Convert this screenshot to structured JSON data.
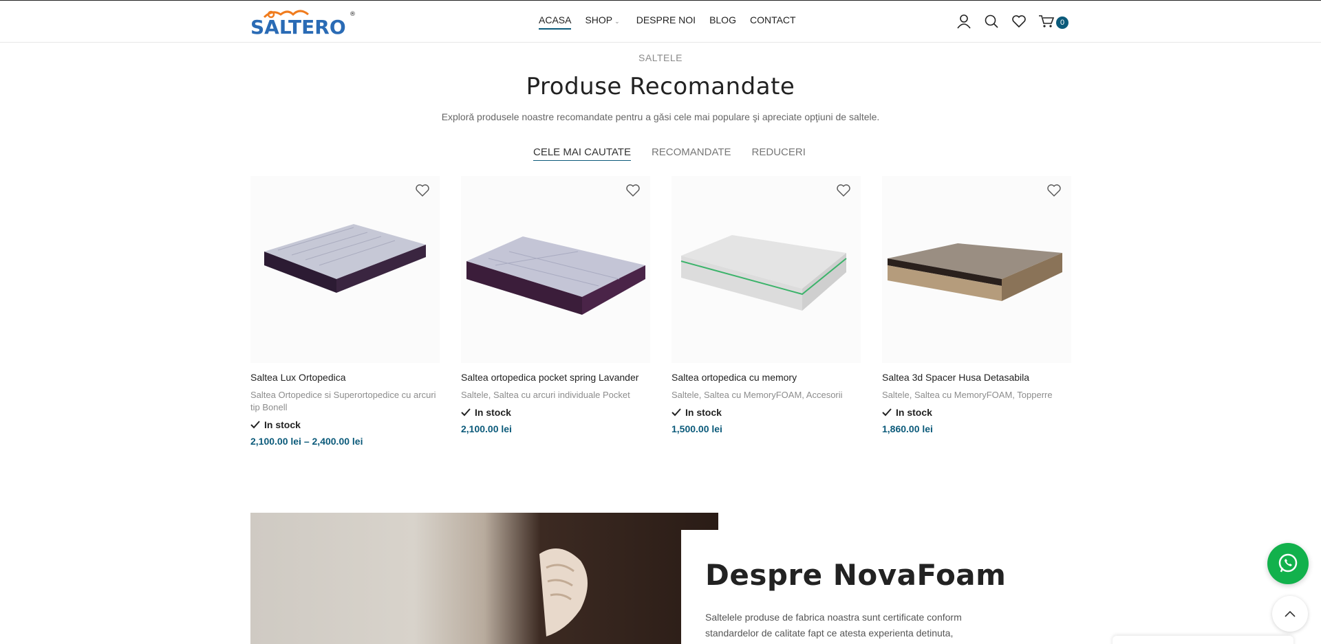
{
  "header": {
    "logo_text": "SALTERO",
    "nav": [
      {
        "label": "ACASA"
      },
      {
        "label": "SHOP"
      },
      {
        "label": "DESPRE NOI"
      },
      {
        "label": "BLOG"
      },
      {
        "label": "CONTACT"
      }
    ],
    "cart_count": "0",
    "icons": [
      "user-icon",
      "search-icon",
      "heart-icon",
      "cart-icon"
    ]
  },
  "section": {
    "eyebrow": "SALTELE",
    "title": "Produse Recomandate",
    "subtitle": "Explorǎ produsele noastre recomandate pentru a gǎsi cele mai populare şi apreciate opţiuni de saltele.",
    "tabs": [
      "CELE MAI CAUTATE",
      "RECOMANDATE",
      "REDUCERI"
    ],
    "active_tab": "CELE MAI CAUTATE"
  },
  "products": [
    {
      "name": "Saltea Lux Ortopedica",
      "categories": "Saltea Ortopedice si Superortopedice cu arcuri tip Bonell",
      "stock": "In stock",
      "price": "2,100.00 lei – 2,400.00 lei"
    },
    {
      "name": "Saltea ortopedica pocket spring Lavander",
      "categories": "Saltele, Saltea cu arcuri individuale Pocket",
      "stock": "In stock",
      "price": "2,100.00 lei"
    },
    {
      "name": "Saltea ortopedica cu memory",
      "categories": "Saltele, Saltea cu MemoryFOAM, Accesorii",
      "stock": "In stock",
      "price": "1,500.00 lei"
    },
    {
      "name": "Saltea 3d Spacer Husa Detasabila",
      "categories": "Saltele, Saltea cu MemoryFOAM, Topperre",
      "stock": "In stock",
      "price": "1,860.00 lei"
    }
  ],
  "about": {
    "title": "Despre NovaFoam",
    "text": "Saltelele produse de fabrica noastra sunt certificate conform standardelor de calitate fapt ce atesta experienta detinuta,"
  },
  "colors": {
    "accent": "#0b5a7a",
    "whatsapp": "#12b14c"
  }
}
